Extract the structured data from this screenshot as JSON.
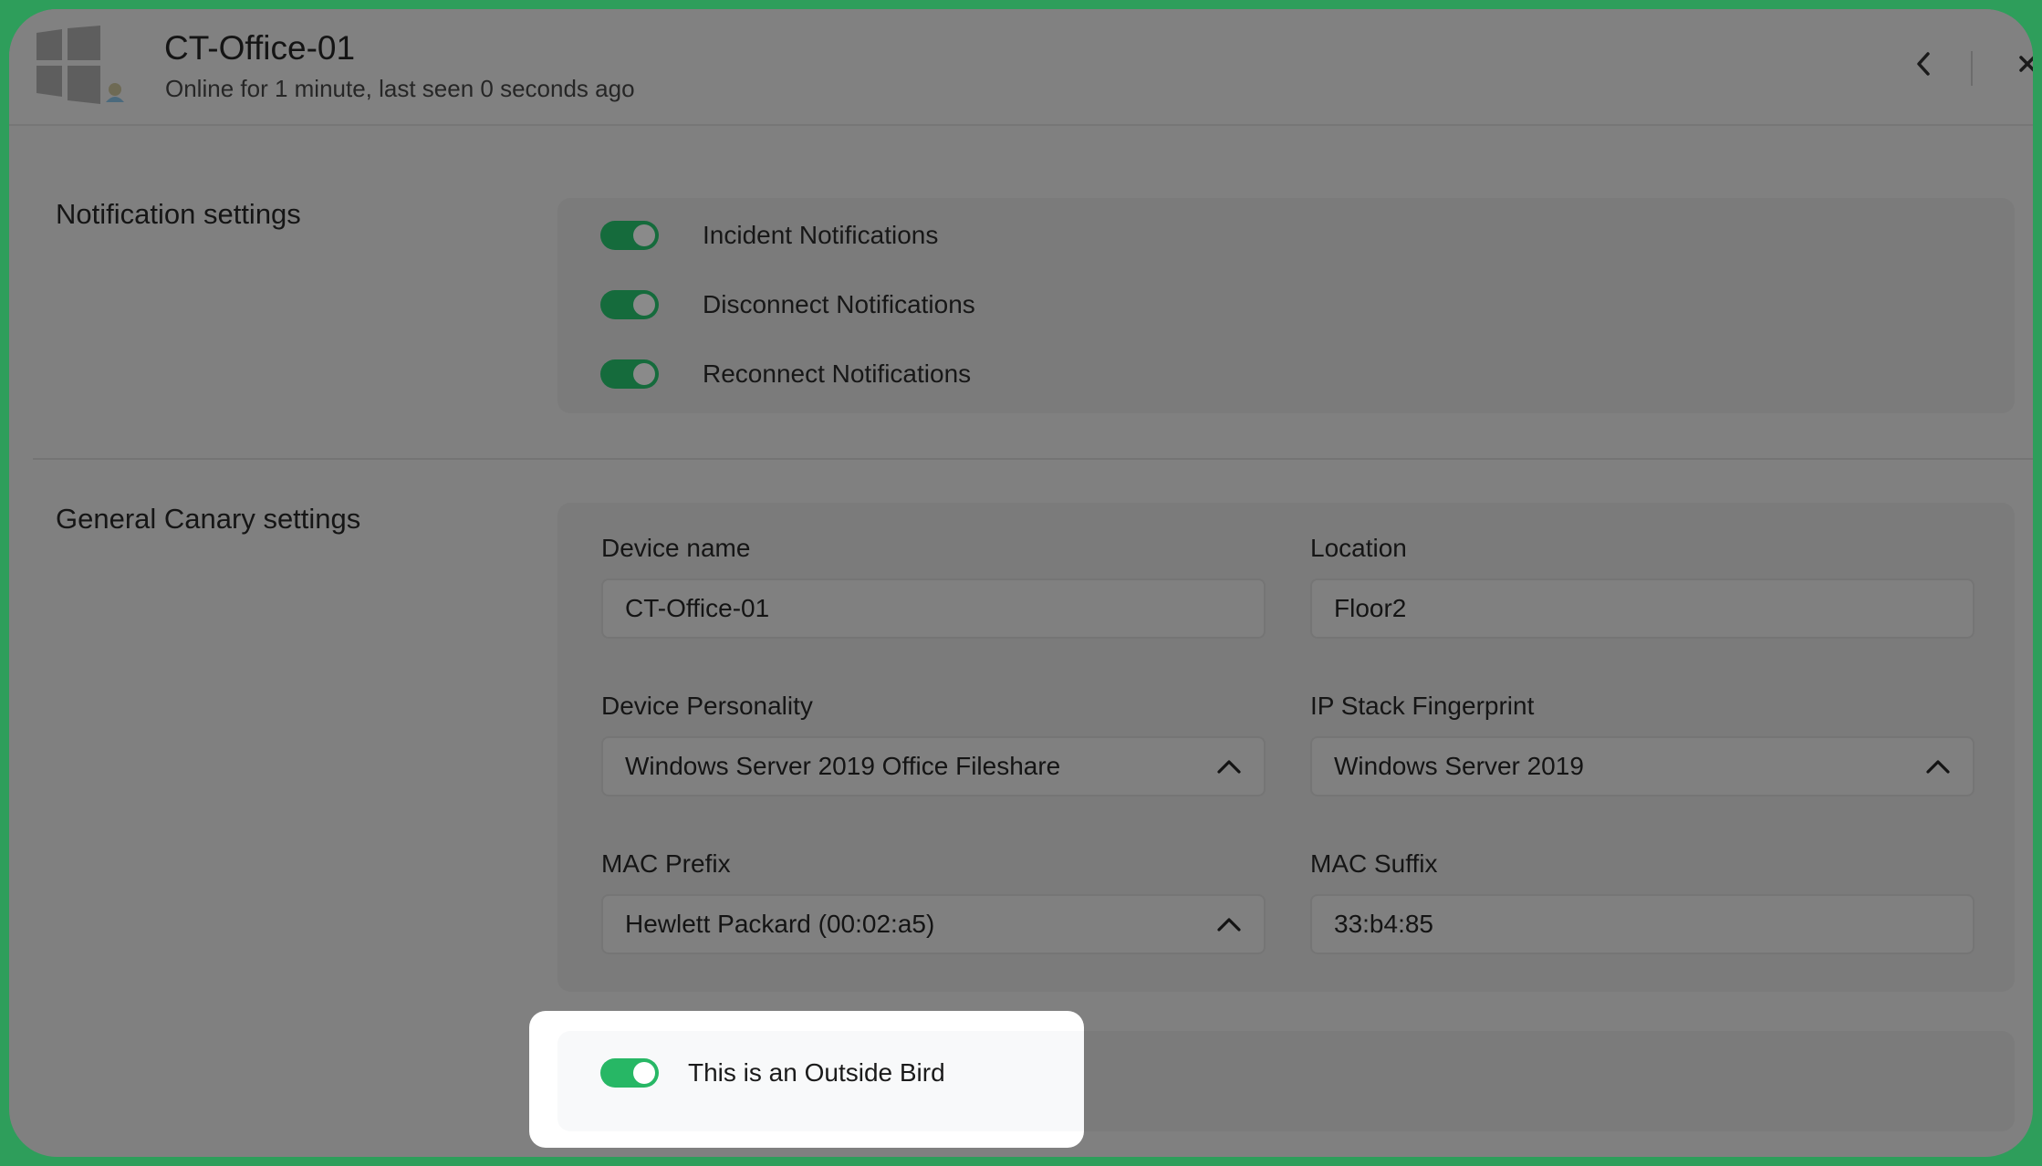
{
  "header": {
    "device_title": "CT-Office-01",
    "status": "Online for 1 minute, last seen 0 seconds ago",
    "icons": {
      "device": "windows-logo-icon",
      "back": "chevron-left-icon",
      "close": "close-icon"
    }
  },
  "notification_settings": {
    "title": "Notification settings",
    "toggles": [
      {
        "label": "Incident Notifications",
        "on": true
      },
      {
        "label": "Disconnect Notifications",
        "on": true
      },
      {
        "label": "Reconnect Notifications",
        "on": true
      }
    ]
  },
  "general_settings": {
    "title": "General Canary settings",
    "device_name": {
      "label": "Device name",
      "value": "CT-Office-01"
    },
    "location": {
      "label": "Location",
      "value": "Floor2"
    },
    "device_personality": {
      "label": "Device Personality",
      "value": "Windows Server 2019 Office Fileshare"
    },
    "ip_stack": {
      "label": "IP Stack Fingerprint",
      "value": "Windows Server 2019"
    },
    "mac_prefix": {
      "label": "MAC Prefix",
      "value": "Hewlett Packard (00:02:a5)"
    },
    "mac_suffix": {
      "label": "MAC Suffix",
      "value": "33:b4:85"
    }
  },
  "outside_bird": {
    "label": "This is an Outside Bird",
    "on": true
  },
  "colors": {
    "border_accent": "#2e9e5b",
    "toggle_active": "#27b765",
    "toggle_dimmed": "#156b3c",
    "overlay": "#808080"
  }
}
